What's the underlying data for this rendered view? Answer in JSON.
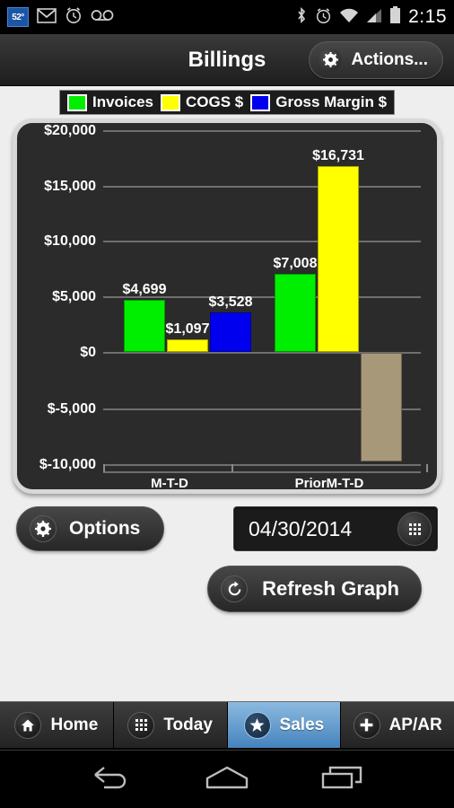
{
  "statusbar": {
    "temperature": "52°",
    "left_icons": [
      "temperature-widget",
      "gmail-icon",
      "alarm-clock-icon",
      "voicemail-icon"
    ],
    "right_icons": [
      "bluetooth-icon",
      "alarm-clock-icon",
      "wifi-icon",
      "cellular-signal-icon",
      "battery-icon"
    ],
    "time": "2:15"
  },
  "actionbar": {
    "title": "Billings",
    "actions_label": "Actions..."
  },
  "chart_data": {
    "type": "bar",
    "title": "Billings",
    "xlabel": "",
    "ylabel": "",
    "categories": [
      "M-T-D",
      "PriorM-T-D"
    ],
    "series": [
      {
        "name": "Invoices",
        "color": "#00ee00",
        "values": [
          4699,
          7008
        ],
        "labels": [
          "$4,699",
          "$7,008"
        ]
      },
      {
        "name": "COGS $",
        "color": "#ffff00",
        "values": [
          1097,
          16731
        ],
        "labels": [
          "$1,097",
          "$16,731"
        ]
      },
      {
        "name": "Gross Margin $",
        "color": "#0000ee",
        "values": [
          3528,
          -9723
        ],
        "labels": [
          "$3,528",
          ""
        ]
      }
    ],
    "ylim": [
      -10000,
      20000
    ],
    "ytick_values": [
      20000,
      15000,
      10000,
      5000,
      0,
      -5000,
      -10000
    ],
    "ytick_labels": [
      "$20,000",
      "$15,000",
      "$10,000",
      "$5,000",
      "$0",
      "$-5,000",
      "$-10,000"
    ],
    "grid": true,
    "legend_position": "top",
    "negative_bar_color": "#a8987a",
    "plot_background": "#2b2b2b"
  },
  "legend": [
    {
      "label": "Invoices",
      "color": "#00ee00"
    },
    {
      "label": "COGS $",
      "color": "#ffff00"
    },
    {
      "label": "Gross Margin $",
      "color": "#0000ee"
    }
  ],
  "controls": {
    "options_label": "Options",
    "date_value": "04/30/2014",
    "date_placeholder": "mm/dd/yyyy",
    "refresh_label": "Refresh Graph"
  },
  "tabs": [
    {
      "label": "Home",
      "icon": "home-icon",
      "active": false
    },
    {
      "label": "Today",
      "icon": "grid-icon",
      "active": false
    },
    {
      "label": "Sales",
      "icon": "star-icon",
      "active": true
    },
    {
      "label": "AP/AR",
      "icon": "plus-icon",
      "active": false
    }
  ],
  "navbar": {
    "back": "back-icon",
    "home": "home-icon",
    "recents": "recents-icon"
  },
  "colors": {
    "accent": "#4583bd",
    "page_background": "#eeeeee",
    "chart_background": "#2b2b2b",
    "chart_border": "#d8d8d8"
  }
}
